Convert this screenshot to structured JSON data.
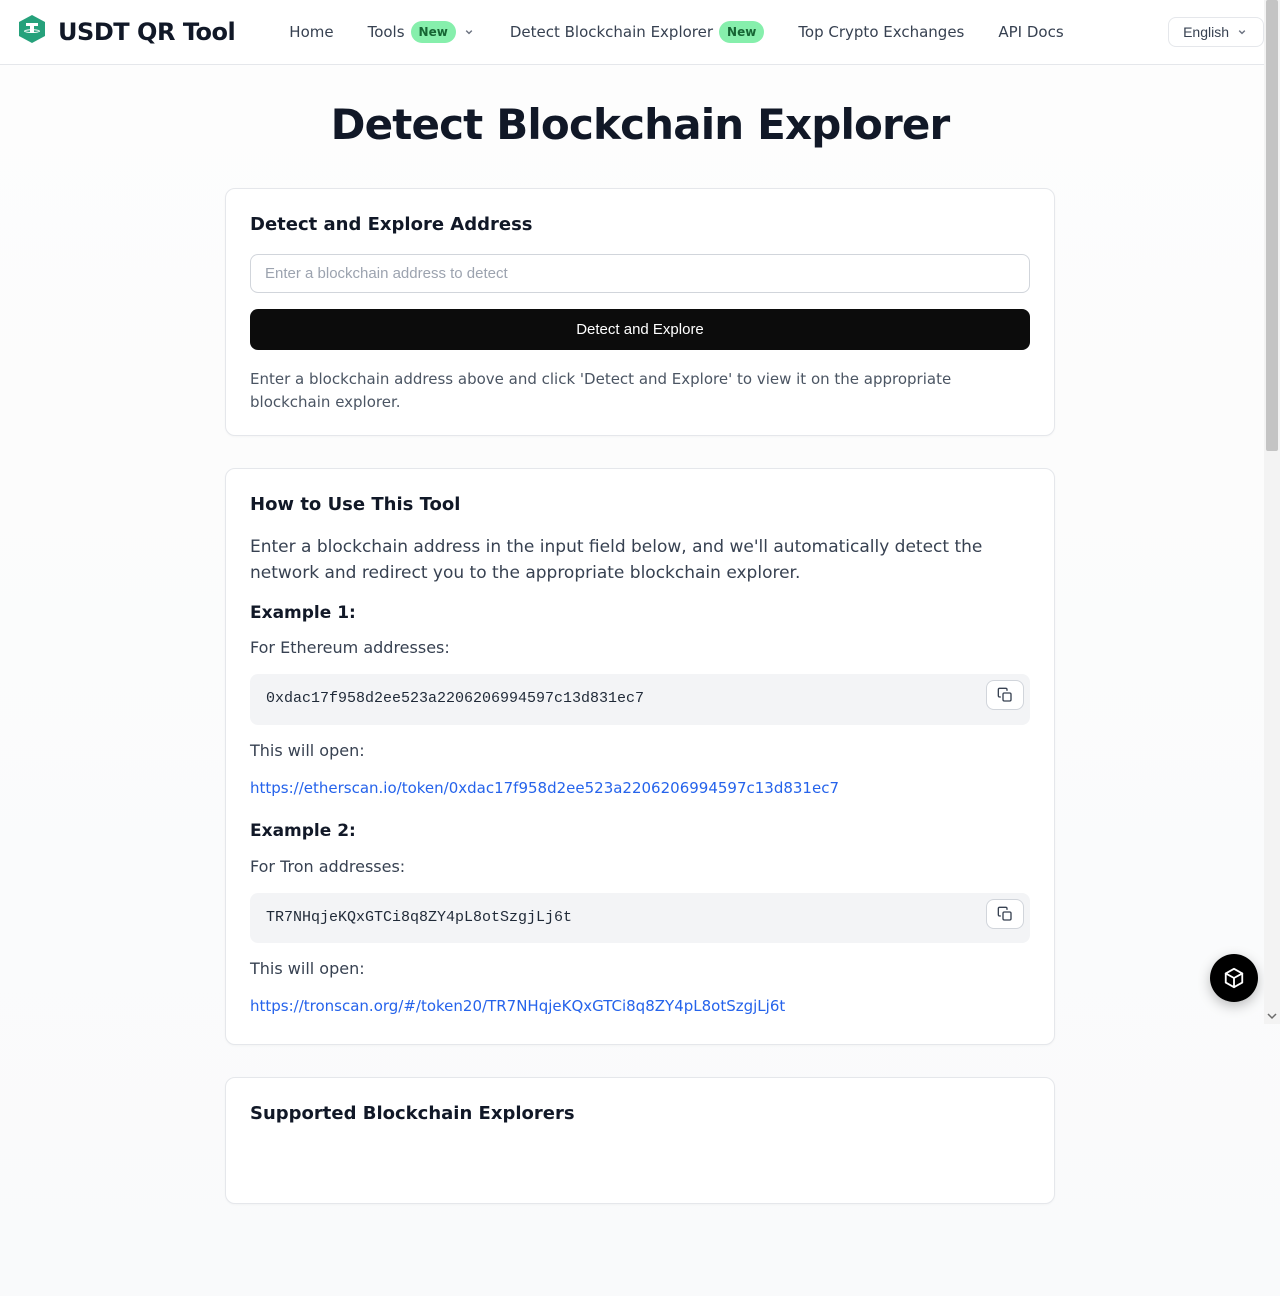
{
  "brand": {
    "name": "USDT QR Tool"
  },
  "nav": {
    "home": "Home",
    "tools": "Tools",
    "tools_badge": "New",
    "detect": "Detect Blockchain Explorer",
    "detect_badge": "New",
    "exchanges": "Top Crypto Exchanges",
    "api": "API Docs"
  },
  "lang": {
    "label": "English"
  },
  "page": {
    "title": "Detect Blockchain Explorer"
  },
  "detect_card": {
    "heading": "Detect and Explore Address",
    "placeholder": "Enter a blockchain address to detect",
    "button": "Detect and Explore",
    "hint": "Enter a blockchain address above and click 'Detect and Explore' to view it on the appropriate blockchain explorer."
  },
  "howto": {
    "heading": "How to Use This Tool",
    "intro": "Enter a blockchain address in the input field below, and we'll automatically detect the network and redirect you to the appropriate blockchain explorer.",
    "ex1_h": "Example 1:",
    "ex1_label": "For Ethereum addresses:",
    "ex1_code": "0xdac17f958d2ee523a2206206994597c13d831ec7",
    "open_label": "This will open:",
    "ex1_url": "https://etherscan.io/token/0xdac17f958d2ee523a2206206994597c13d831ec7",
    "ex2_h": "Example 2:",
    "ex2_label": "For Tron addresses:",
    "ex2_code": "TR7NHqjeKQxGTCi8q8ZY4pL8otSzgjLj6t",
    "ex2_url": "https://tronscan.org/#/token20/TR7NHqjeKQxGTCi8q8ZY4pL8otSzgjLj6t"
  },
  "supported": {
    "heading": "Supported Blockchain Explorers"
  }
}
